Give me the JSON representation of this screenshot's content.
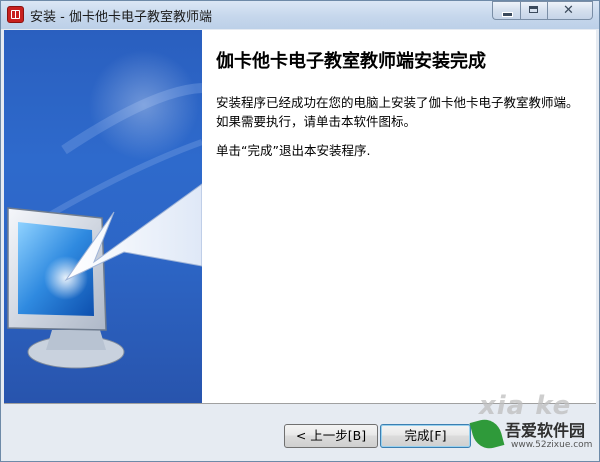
{
  "window": {
    "title": "安装 - 伽卡他卡电子教室教师端",
    "controls": {
      "minimize": "minimize-icon",
      "maximize": "maximize-icon",
      "close": "close-icon"
    }
  },
  "main": {
    "heading": "伽卡他卡电子教室教师端安装完成",
    "description": "安装程序已经成功在您的电脑上安装了伽卡他卡电子教室教师端。如果需要执行，请单击本软件图标。",
    "exit_note": "单击“完成”退出本安装程序."
  },
  "buttons": {
    "back": "< 上一步[B]",
    "finish": "完成[F]"
  },
  "watermark": {
    "big_text": "xia ke",
    "name": "吾爱软件园",
    "url": "www.52zixue.com"
  },
  "colors": {
    "banner_blue": "#2e6acc",
    "title_bar": "#c6d7ec"
  }
}
